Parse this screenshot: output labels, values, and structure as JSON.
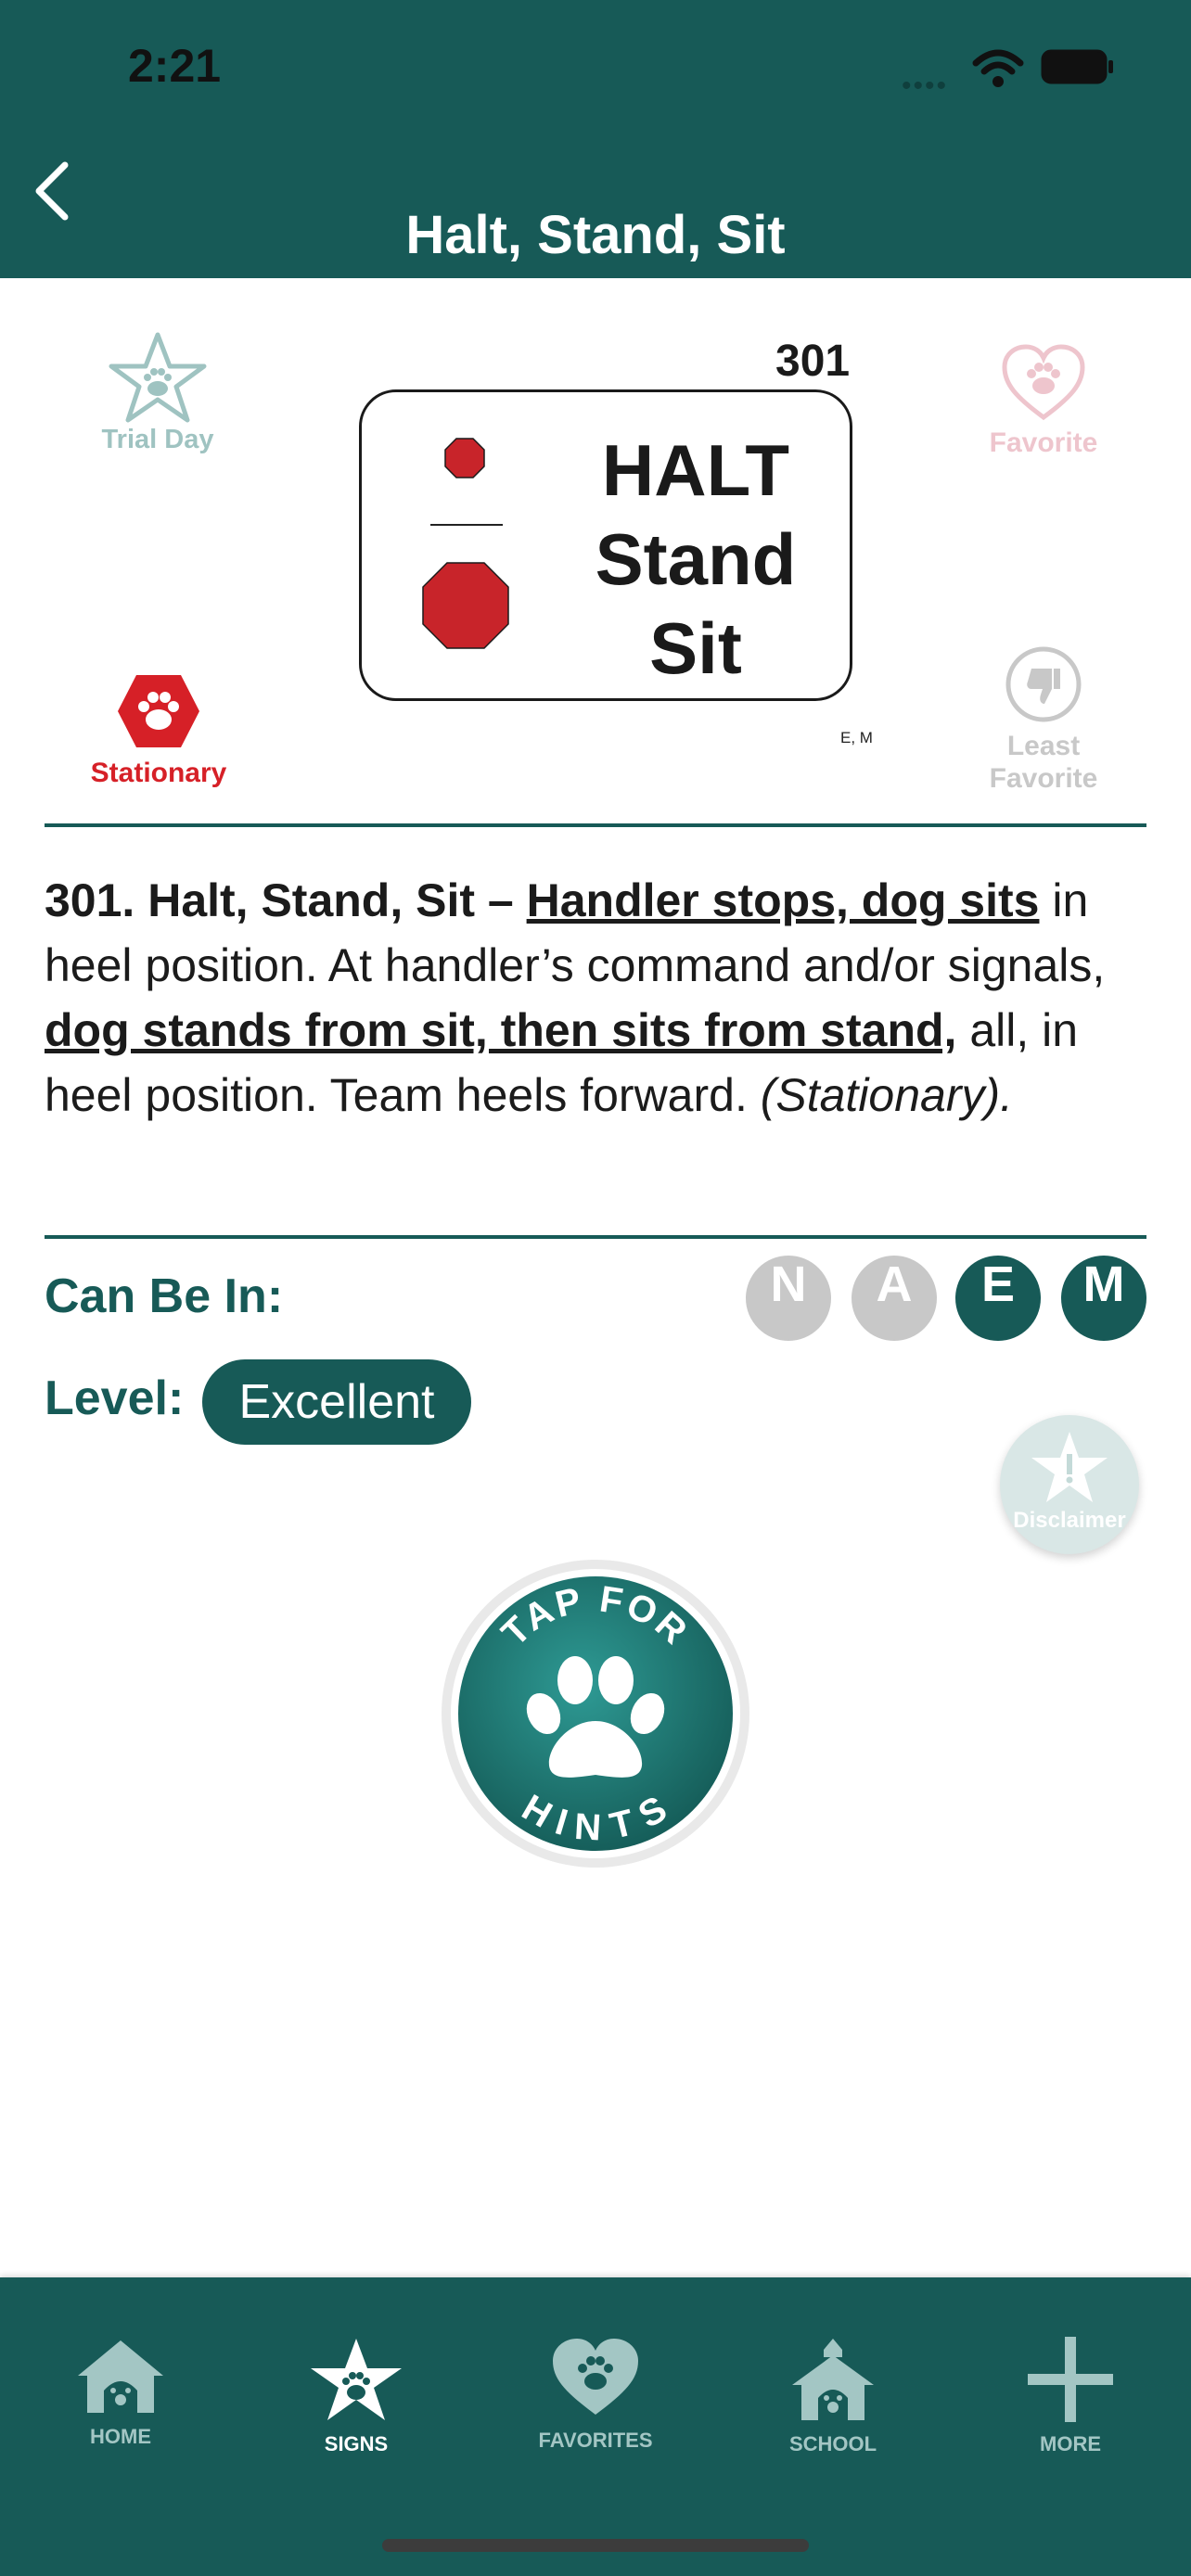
{
  "status": {
    "time": "2:21"
  },
  "nav": {
    "title": "Halt, Stand, Sit"
  },
  "sign": {
    "number": "301",
    "card_lines": [
      "HALT",
      "Stand",
      "Sit"
    ],
    "levels_tag": "E, M"
  },
  "badges": {
    "trial_day": "Trial Day",
    "favorite": "Favorite",
    "stationary": "Stationary",
    "least_favorite_1": "Least",
    "least_favorite_2": "Favorite"
  },
  "description": {
    "lead": "301. Halt, Stand, Sit – ",
    "u1": "Handler stops, dog sits",
    "t1": " in heel position. At handler’s command and/or signals, ",
    "u2": "dog stands from sit, then sits from stand,",
    "t2": " all, in heel position. Team heels forward. ",
    "note": "(Stationary)."
  },
  "can_be_in": {
    "label": "Can Be In:",
    "levels": [
      {
        "letter": "N",
        "color": "#c8c8c8"
      },
      {
        "letter": "A",
        "color": "#c8c8c8"
      },
      {
        "letter": "E",
        "color": "#175a57"
      },
      {
        "letter": "M",
        "color": "#175a57"
      }
    ]
  },
  "level": {
    "label": "Level:",
    "value": "Excellent"
  },
  "disclaimer": {
    "label": "Disclaimer"
  },
  "hints": {
    "top_text": "TAP FOR",
    "bottom_text": "HINTS"
  },
  "tabs": [
    {
      "label": "HOME",
      "color": "#a3c6c4"
    },
    {
      "label": "SIGNS",
      "color": "#ffffff"
    },
    {
      "label": "FAVORITES",
      "color": "#a3c6c4"
    },
    {
      "label": "SCHOOL",
      "color": "#a3c6c4"
    },
    {
      "label": "MORE",
      "color": "#a3c6c4"
    }
  ],
  "colors": {
    "brand_teal": "#175a57",
    "stop_red": "#c8242a",
    "stationary_red": "#d62027"
  }
}
